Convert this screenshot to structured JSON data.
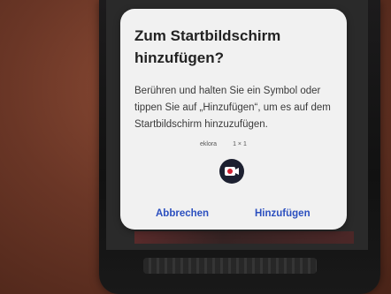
{
  "dialog": {
    "title": "Zum Startbildschirm hinzufügen?",
    "body": "Berühren und halten Sie ein Symbol oder tippen Sie auf „Hinzufügen“, um es auf dem Startbildschirm hinzuzufügen.",
    "shortcut": {
      "app_name": "eklora",
      "size": "1 × 1",
      "icon": "app-shortcut-icon"
    },
    "cancel_label": "Abbrechen",
    "add_label": "Hinzufügen"
  },
  "colors": {
    "dialog_bg": "#f1f1f1",
    "button_text": "#2b4fbf",
    "background": "#6a3a2a"
  }
}
